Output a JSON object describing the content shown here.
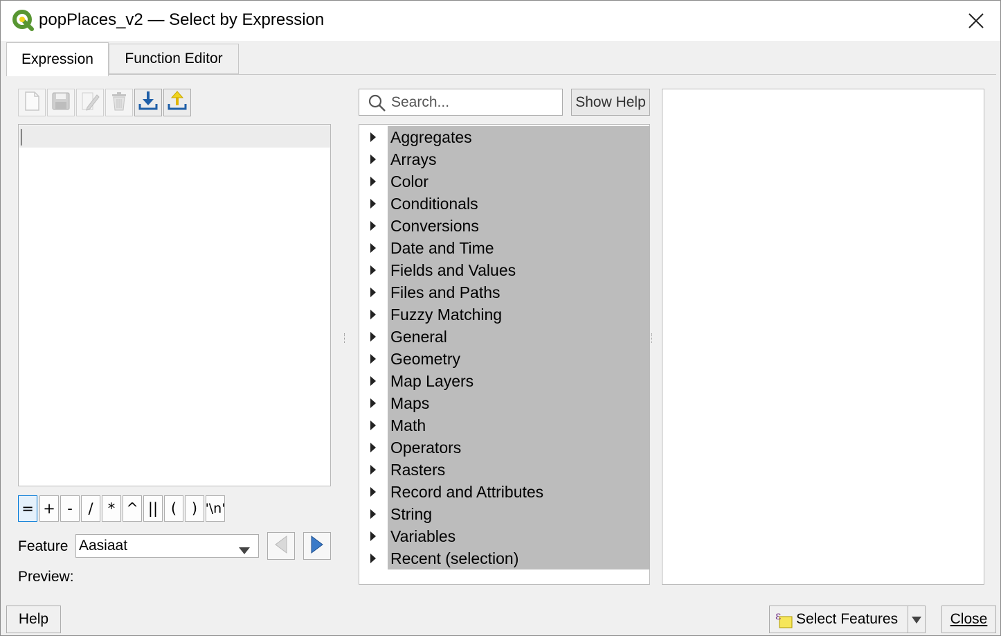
{
  "window": {
    "title": "popPlaces_v2 — Select by Expression",
    "close_icon": "close-icon"
  },
  "tabs": [
    {
      "label": "Expression",
      "active": true
    },
    {
      "label": "Function Editor",
      "active": false
    }
  ],
  "toolbar": [
    {
      "icon": "new-file-icon",
      "enabled": false
    },
    {
      "icon": "save-icon",
      "enabled": false
    },
    {
      "icon": "edit-icon",
      "enabled": false
    },
    {
      "icon": "delete-icon",
      "enabled": false
    },
    {
      "icon": "import-icon",
      "enabled": true
    },
    {
      "icon": "export-icon",
      "enabled": true
    }
  ],
  "editor": {
    "value": ""
  },
  "operators": [
    "=",
    "+",
    "-",
    "/",
    "*",
    "^",
    "||",
    "(",
    ")",
    "'\\n'"
  ],
  "feature": {
    "label": "Feature",
    "value": "Aasiaat"
  },
  "preview": {
    "label": "Preview:"
  },
  "search": {
    "placeholder": "Search..."
  },
  "show_help": {
    "label": "Show Help"
  },
  "function_tree": [
    "Aggregates",
    "Arrays",
    "Color",
    "Conditionals",
    "Conversions",
    "Date and Time",
    "Fields and Values",
    "Files and Paths",
    "Fuzzy Matching",
    "General",
    "Geometry",
    "Map Layers",
    "Maps",
    "Math",
    "Operators",
    "Rasters",
    "Record and Attributes",
    "String",
    "Variables",
    "Recent (selection)"
  ],
  "footer": {
    "help": "Help",
    "select_features": "Select Features",
    "close": "Close"
  },
  "colors": {
    "accent": "#0078d7",
    "selection": "#bcbcbc",
    "qgis_green": "#589632",
    "qgis_yellow": "#f0d41e"
  }
}
